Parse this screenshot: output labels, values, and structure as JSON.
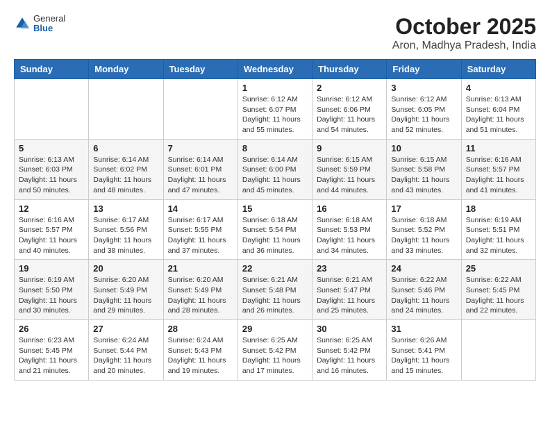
{
  "header": {
    "logo": {
      "general": "General",
      "blue": "Blue"
    },
    "title": "October 2025",
    "location": "Aron, Madhya Pradesh, India"
  },
  "weekdays": [
    "Sunday",
    "Monday",
    "Tuesday",
    "Wednesday",
    "Thursday",
    "Friday",
    "Saturday"
  ],
  "weeks": [
    [
      {
        "day": "",
        "info": ""
      },
      {
        "day": "",
        "info": ""
      },
      {
        "day": "",
        "info": ""
      },
      {
        "day": "1",
        "info": "Sunrise: 6:12 AM\nSunset: 6:07 PM\nDaylight: 11 hours\nand 55 minutes."
      },
      {
        "day": "2",
        "info": "Sunrise: 6:12 AM\nSunset: 6:06 PM\nDaylight: 11 hours\nand 54 minutes."
      },
      {
        "day": "3",
        "info": "Sunrise: 6:12 AM\nSunset: 6:05 PM\nDaylight: 11 hours\nand 52 minutes."
      },
      {
        "day": "4",
        "info": "Sunrise: 6:13 AM\nSunset: 6:04 PM\nDaylight: 11 hours\nand 51 minutes."
      }
    ],
    [
      {
        "day": "5",
        "info": "Sunrise: 6:13 AM\nSunset: 6:03 PM\nDaylight: 11 hours\nand 50 minutes."
      },
      {
        "day": "6",
        "info": "Sunrise: 6:14 AM\nSunset: 6:02 PM\nDaylight: 11 hours\nand 48 minutes."
      },
      {
        "day": "7",
        "info": "Sunrise: 6:14 AM\nSunset: 6:01 PM\nDaylight: 11 hours\nand 47 minutes."
      },
      {
        "day": "8",
        "info": "Sunrise: 6:14 AM\nSunset: 6:00 PM\nDaylight: 11 hours\nand 45 minutes."
      },
      {
        "day": "9",
        "info": "Sunrise: 6:15 AM\nSunset: 5:59 PM\nDaylight: 11 hours\nand 44 minutes."
      },
      {
        "day": "10",
        "info": "Sunrise: 6:15 AM\nSunset: 5:58 PM\nDaylight: 11 hours\nand 43 minutes."
      },
      {
        "day": "11",
        "info": "Sunrise: 6:16 AM\nSunset: 5:57 PM\nDaylight: 11 hours\nand 41 minutes."
      }
    ],
    [
      {
        "day": "12",
        "info": "Sunrise: 6:16 AM\nSunset: 5:57 PM\nDaylight: 11 hours\nand 40 minutes."
      },
      {
        "day": "13",
        "info": "Sunrise: 6:17 AM\nSunset: 5:56 PM\nDaylight: 11 hours\nand 38 minutes."
      },
      {
        "day": "14",
        "info": "Sunrise: 6:17 AM\nSunset: 5:55 PM\nDaylight: 11 hours\nand 37 minutes."
      },
      {
        "day": "15",
        "info": "Sunrise: 6:18 AM\nSunset: 5:54 PM\nDaylight: 11 hours\nand 36 minutes."
      },
      {
        "day": "16",
        "info": "Sunrise: 6:18 AM\nSunset: 5:53 PM\nDaylight: 11 hours\nand 34 minutes."
      },
      {
        "day": "17",
        "info": "Sunrise: 6:18 AM\nSunset: 5:52 PM\nDaylight: 11 hours\nand 33 minutes."
      },
      {
        "day": "18",
        "info": "Sunrise: 6:19 AM\nSunset: 5:51 PM\nDaylight: 11 hours\nand 32 minutes."
      }
    ],
    [
      {
        "day": "19",
        "info": "Sunrise: 6:19 AM\nSunset: 5:50 PM\nDaylight: 11 hours\nand 30 minutes."
      },
      {
        "day": "20",
        "info": "Sunrise: 6:20 AM\nSunset: 5:49 PM\nDaylight: 11 hours\nand 29 minutes."
      },
      {
        "day": "21",
        "info": "Sunrise: 6:20 AM\nSunset: 5:49 PM\nDaylight: 11 hours\nand 28 minutes."
      },
      {
        "day": "22",
        "info": "Sunrise: 6:21 AM\nSunset: 5:48 PM\nDaylight: 11 hours\nand 26 minutes."
      },
      {
        "day": "23",
        "info": "Sunrise: 6:21 AM\nSunset: 5:47 PM\nDaylight: 11 hours\nand 25 minutes."
      },
      {
        "day": "24",
        "info": "Sunrise: 6:22 AM\nSunset: 5:46 PM\nDaylight: 11 hours\nand 24 minutes."
      },
      {
        "day": "25",
        "info": "Sunrise: 6:22 AM\nSunset: 5:45 PM\nDaylight: 11 hours\nand 22 minutes."
      }
    ],
    [
      {
        "day": "26",
        "info": "Sunrise: 6:23 AM\nSunset: 5:45 PM\nDaylight: 11 hours\nand 21 minutes."
      },
      {
        "day": "27",
        "info": "Sunrise: 6:24 AM\nSunset: 5:44 PM\nDaylight: 11 hours\nand 20 minutes."
      },
      {
        "day": "28",
        "info": "Sunrise: 6:24 AM\nSunset: 5:43 PM\nDaylight: 11 hours\nand 19 minutes."
      },
      {
        "day": "29",
        "info": "Sunrise: 6:25 AM\nSunset: 5:42 PM\nDaylight: 11 hours\nand 17 minutes."
      },
      {
        "day": "30",
        "info": "Sunrise: 6:25 AM\nSunset: 5:42 PM\nDaylight: 11 hours\nand 16 minutes."
      },
      {
        "day": "31",
        "info": "Sunrise: 6:26 AM\nSunset: 5:41 PM\nDaylight: 11 hours\nand 15 minutes."
      },
      {
        "day": "",
        "info": ""
      }
    ]
  ]
}
